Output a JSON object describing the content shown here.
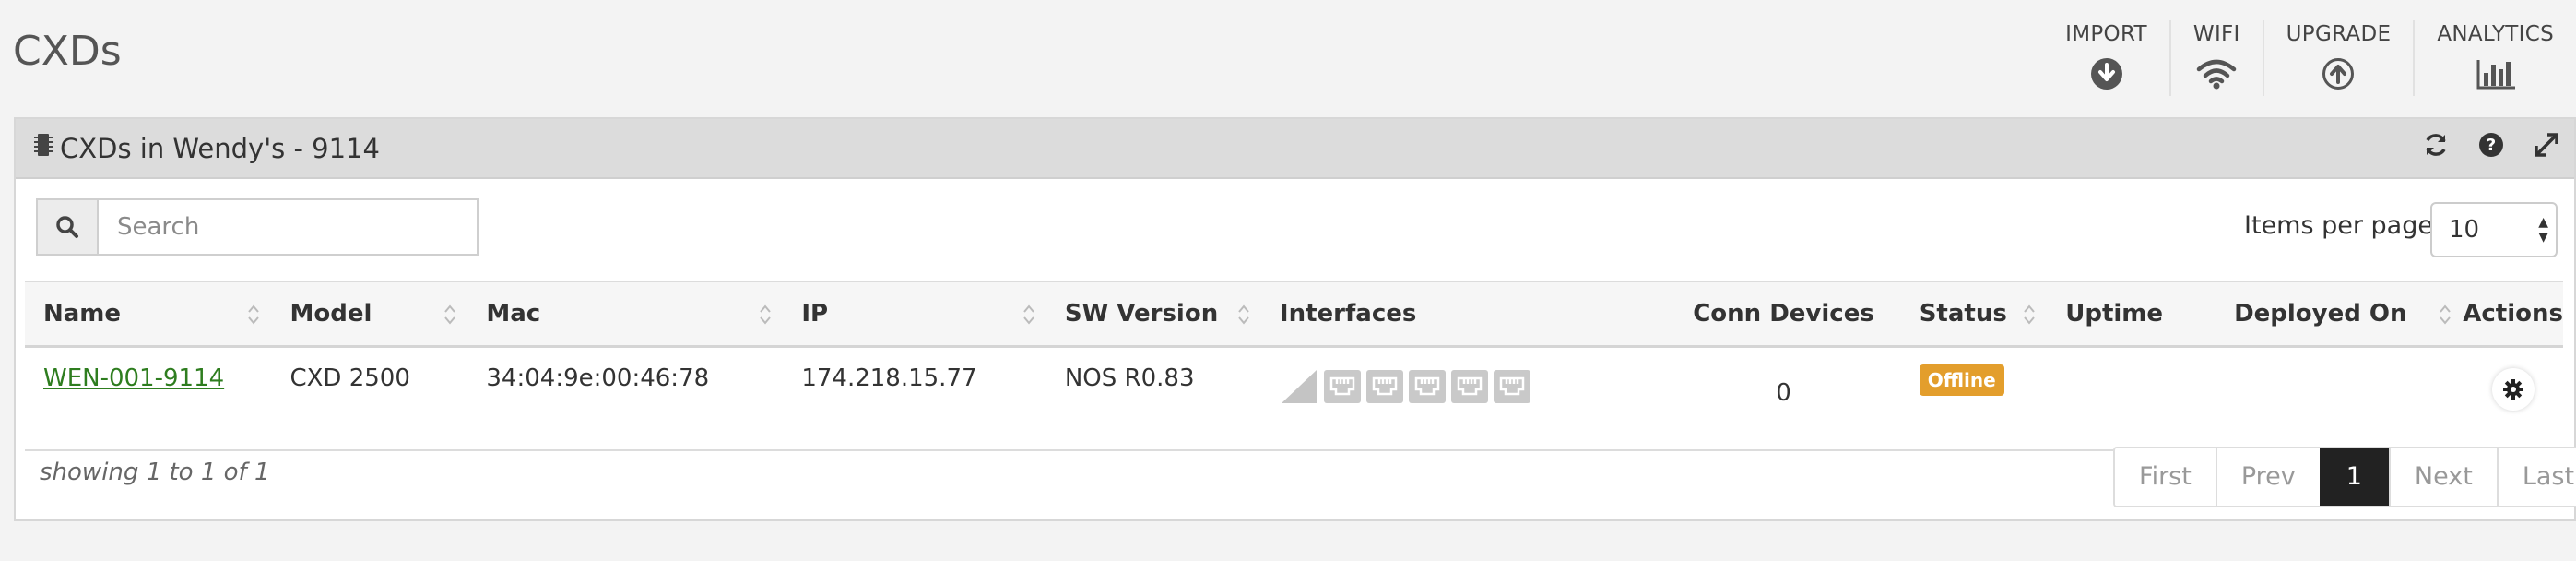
{
  "page": {
    "title": "CXDs"
  },
  "actions": [
    {
      "label": "IMPORT",
      "icon": "download-circle-icon"
    },
    {
      "label": "WIFI",
      "icon": "wifi-icon"
    },
    {
      "label": "UPGRADE",
      "icon": "upload-circle-icon"
    },
    {
      "label": "ANALYTICS",
      "icon": "bar-chart-icon"
    }
  ],
  "panel": {
    "title": "CXDs in Wendy's - 9114",
    "tools": [
      "refresh-icon",
      "help-icon",
      "expand-icon"
    ]
  },
  "search": {
    "placeholder": "Search",
    "value": ""
  },
  "items_per_page": {
    "label": "Items per page",
    "value": "10"
  },
  "table": {
    "columns": [
      "Name",
      "Model",
      "Mac",
      "IP",
      "SW Version",
      "Interfaces",
      "Conn Devices",
      "Status",
      "Uptime",
      "Deployed On",
      "Actions"
    ],
    "rows": [
      {
        "name": "WEN-001-9114",
        "model": "CXD 2500",
        "mac": "34:04:9e:00:46:78",
        "ip": "174.218.15.77",
        "sw_version": "NOS R0.83",
        "conn_devices": "0",
        "status": "Offline",
        "uptime": "",
        "deployed_on": ""
      }
    ]
  },
  "footer": {
    "showing": "showing 1 to 1 of 1"
  },
  "pagination": {
    "first": "First",
    "prev": "Prev",
    "current": "1",
    "next": "Next",
    "last": "Last"
  },
  "colors": {
    "accent_link": "#2e7d1f",
    "status_offline": "#e39e2c",
    "pager_active": "#222222"
  }
}
